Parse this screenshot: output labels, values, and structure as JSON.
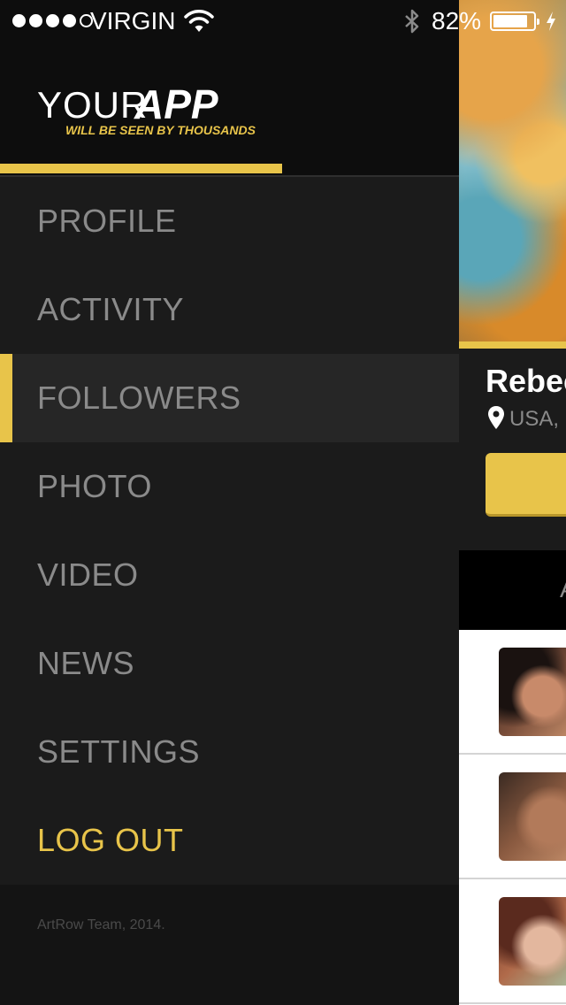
{
  "status_bar": {
    "carrier": "VIRGIN",
    "battery_percent_text": "82%",
    "battery_level": 0.82,
    "signal_bars_filled": 4,
    "signal_bars_total": 5,
    "icons": [
      "wifi-icon",
      "bluetooth-icon",
      "battery-icon",
      "charging-icon"
    ]
  },
  "menu": {
    "logo": {
      "your": "YOUR",
      "app": "APP",
      "tagline": "WILL BE SEEN BY THOUSANDS"
    },
    "items": [
      {
        "label": "PROFILE"
      },
      {
        "label": "ACTIVITY"
      },
      {
        "label": "FOLLOWERS",
        "active": true
      },
      {
        "label": "PHOTO"
      },
      {
        "label": "VIDEO"
      },
      {
        "label": "NEWS"
      },
      {
        "label": "SETTINGS"
      },
      {
        "label": "LOG OUT"
      }
    ],
    "copyright": "ArtRow Team, 2014."
  },
  "profile": {
    "name": "Rebec",
    "location": "USA, F",
    "tab_label": "A"
  },
  "followers": {
    "count_visible": 3
  },
  "colors": {
    "accent": "#e8c44a",
    "menu_bg": "#1b1b1b",
    "header_bg": "#0d0d0d",
    "menu_text": "#8a8a8a"
  }
}
